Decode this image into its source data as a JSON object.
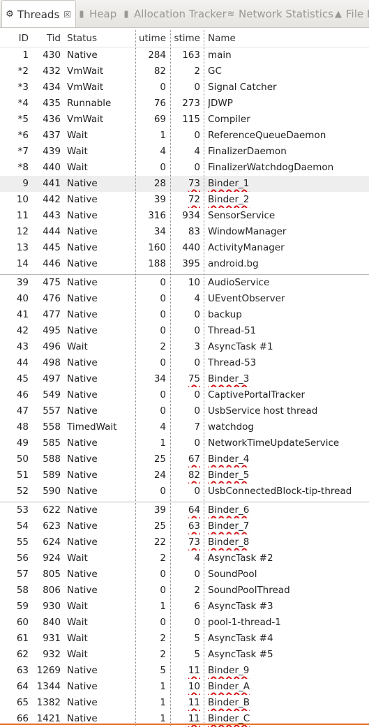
{
  "tabs": [
    {
      "label": "Threads",
      "icon": "threads-icon",
      "active": true,
      "close": "☒"
    },
    {
      "label": "Heap",
      "icon": "heap-icon",
      "active": false
    },
    {
      "label": "Allocation Tracker",
      "icon": "allocation-icon",
      "active": false
    },
    {
      "label": "Network Statistics",
      "icon": "network-icon",
      "active": false
    },
    {
      "label": "File E",
      "icon": "android-icon",
      "active": false
    }
  ],
  "columns": {
    "id": "ID",
    "tid": "Tid",
    "status": "Status",
    "utime": "utime",
    "stime": "stime",
    "name": "Name"
  },
  "rows": [
    {
      "id": "1",
      "tid": "430",
      "status": "Native",
      "utime": "284",
      "stime": "163",
      "name": "main"
    },
    {
      "id": "*2",
      "tid": "432",
      "status": "VmWait",
      "utime": "82",
      "stime": "2",
      "name": "GC"
    },
    {
      "id": "*3",
      "tid": "434",
      "status": "VmWait",
      "utime": "0",
      "stime": "0",
      "name": "Signal Catcher"
    },
    {
      "id": "*4",
      "tid": "435",
      "status": "Runnable",
      "utime": "76",
      "stime": "273",
      "name": "JDWP"
    },
    {
      "id": "*5",
      "tid": "436",
      "status": "VmWait",
      "utime": "69",
      "stime": "115",
      "name": "Compiler"
    },
    {
      "id": "*6",
      "tid": "437",
      "status": "Wait",
      "utime": "1",
      "stime": "0",
      "name": "ReferenceQueueDaemon"
    },
    {
      "id": "*7",
      "tid": "439",
      "status": "Wait",
      "utime": "4",
      "stime": "4",
      "name": "FinalizerDaemon"
    },
    {
      "id": "*8",
      "tid": "440",
      "status": "Wait",
      "utime": "0",
      "stime": "0",
      "name": "FinalizerWatchdogDaemon"
    },
    {
      "id": "9",
      "tid": "441",
      "status": "Native",
      "utime": "28",
      "stime": "73",
      "name": "Binder_1",
      "mark": true,
      "hl": true
    },
    {
      "id": "10",
      "tid": "442",
      "status": "Native",
      "utime": "39",
      "stime": "72",
      "name": "Binder_2",
      "mark": true
    },
    {
      "id": "11",
      "tid": "443",
      "status": "Native",
      "utime": "316",
      "stime": "934",
      "name": "SensorService"
    },
    {
      "id": "12",
      "tid": "444",
      "status": "Native",
      "utime": "34",
      "stime": "83",
      "name": "WindowManager"
    },
    {
      "id": "13",
      "tid": "445",
      "status": "Native",
      "utime": "160",
      "stime": "440",
      "name": "ActivityManager"
    },
    {
      "id": "14",
      "tid": "446",
      "status": "Native",
      "utime": "188",
      "stime": "395",
      "name": "android.bg"
    },
    {
      "id": "39",
      "tid": "475",
      "status": "Native",
      "utime": "0",
      "stime": "10",
      "name": "AudioService",
      "sep": true
    },
    {
      "id": "40",
      "tid": "476",
      "status": "Native",
      "utime": "0",
      "stime": "4",
      "name": "UEventObserver"
    },
    {
      "id": "41",
      "tid": "477",
      "status": "Native",
      "utime": "0",
      "stime": "0",
      "name": "backup"
    },
    {
      "id": "42",
      "tid": "495",
      "status": "Native",
      "utime": "0",
      "stime": "0",
      "name": "Thread-51"
    },
    {
      "id": "43",
      "tid": "496",
      "status": "Wait",
      "utime": "2",
      "stime": "3",
      "name": "AsyncTask #1"
    },
    {
      "id": "44",
      "tid": "498",
      "status": "Native",
      "utime": "0",
      "stime": "0",
      "name": "Thread-53"
    },
    {
      "id": "45",
      "tid": "497",
      "status": "Native",
      "utime": "34",
      "stime": "75",
      "name": "Binder_3",
      "mark": true
    },
    {
      "id": "46",
      "tid": "549",
      "status": "Native",
      "utime": "0",
      "stime": "0",
      "name": "CaptivePortalTracker"
    },
    {
      "id": "47",
      "tid": "557",
      "status": "Native",
      "utime": "0",
      "stime": "0",
      "name": "UsbService host thread"
    },
    {
      "id": "48",
      "tid": "558",
      "status": "TimedWait",
      "utime": "4",
      "stime": "7",
      "name": "watchdog"
    },
    {
      "id": "49",
      "tid": "585",
      "status": "Native",
      "utime": "1",
      "stime": "0",
      "name": "NetworkTimeUpdateService"
    },
    {
      "id": "50",
      "tid": "588",
      "status": "Native",
      "utime": "25",
      "stime": "67",
      "name": "Binder_4",
      "mark": true
    },
    {
      "id": "51",
      "tid": "589",
      "status": "Native",
      "utime": "24",
      "stime": "82",
      "name": "Binder_5",
      "mark": true
    },
    {
      "id": "52",
      "tid": "590",
      "status": "Native",
      "utime": "0",
      "stime": "0",
      "name": "UsbConnectedBlock-tip-thread"
    },
    {
      "id": "53",
      "tid": "622",
      "status": "Native",
      "utime": "39",
      "stime": "64",
      "name": "Binder_6",
      "mark": true,
      "sep": true
    },
    {
      "id": "54",
      "tid": "623",
      "status": "Native",
      "utime": "25",
      "stime": "63",
      "name": "Binder_7",
      "mark": true
    },
    {
      "id": "55",
      "tid": "624",
      "status": "Native",
      "utime": "22",
      "stime": "73",
      "name": "Binder_8",
      "mark": true
    },
    {
      "id": "56",
      "tid": "924",
      "status": "Wait",
      "utime": "2",
      "stime": "4",
      "name": "AsyncTask #2"
    },
    {
      "id": "57",
      "tid": "805",
      "status": "Native",
      "utime": "0",
      "stime": "0",
      "name": "SoundPool"
    },
    {
      "id": "58",
      "tid": "806",
      "status": "Native",
      "utime": "0",
      "stime": "2",
      "name": "SoundPoolThread"
    },
    {
      "id": "59",
      "tid": "930",
      "status": "Wait",
      "utime": "1",
      "stime": "6",
      "name": "AsyncTask #3"
    },
    {
      "id": "60",
      "tid": "840",
      "status": "Wait",
      "utime": "0",
      "stime": "0",
      "name": "pool-1-thread-1"
    },
    {
      "id": "61",
      "tid": "931",
      "status": "Wait",
      "utime": "2",
      "stime": "5",
      "name": "AsyncTask #4"
    },
    {
      "id": "62",
      "tid": "932",
      "status": "Wait",
      "utime": "2",
      "stime": "5",
      "name": "AsyncTask #5"
    },
    {
      "id": "63",
      "tid": "1269",
      "status": "Native",
      "utime": "5",
      "stime": "11",
      "name": "Binder_9",
      "mark": true
    },
    {
      "id": "64",
      "tid": "1344",
      "status": "Native",
      "utime": "1",
      "stime": "10",
      "name": "Binder_A",
      "mark": true
    },
    {
      "id": "65",
      "tid": "1382",
      "status": "Native",
      "utime": "1",
      "stime": "11",
      "name": "Binder_B",
      "mark": true
    },
    {
      "id": "66",
      "tid": "1421",
      "status": "Native",
      "utime": "1",
      "stime": "11",
      "name": "Binder_C",
      "mark": true
    }
  ],
  "colors": {
    "annotation": "#d51a1a",
    "selection_line": "#e8722c",
    "row_highlight": "#eeeeee"
  }
}
